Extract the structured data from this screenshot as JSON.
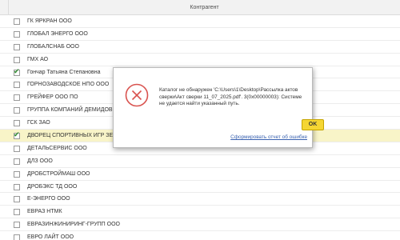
{
  "table": {
    "column_header": "Контрагент",
    "rows": [
      {
        "name": "ГК ЯРКРАН ООО",
        "checked": false
      },
      {
        "name": "ГЛОБАЛ ЭНЕРГО ООО",
        "checked": false
      },
      {
        "name": "ГЛОБАЛСНАБ ООО",
        "checked": false
      },
      {
        "name": "ГМХ АО",
        "checked": false
      },
      {
        "name": "Гончар Татьяна Степановна",
        "checked": true
      },
      {
        "name": "ГОРНОЗАВОДСКОЕ НПО ООО",
        "checked": false
      },
      {
        "name": "ГРЕЙФЕР ООО ПО",
        "checked": false
      },
      {
        "name": "ГРУППА КОМПАНИЙ ДЕМИДОВ",
        "checked": false
      },
      {
        "name": "ГСК ЗАО",
        "checked": false
      },
      {
        "name": "ДВОРЕЦ СПОРТИВНЫХ ИГР ЗЕ",
        "checked": true
      },
      {
        "name": "ДЕТАЛЬСЕРВИС ООО",
        "checked": false
      },
      {
        "name": "ДЛЗ ООО",
        "checked": false
      },
      {
        "name": "ДРОБСТРОЙМАШ ООО",
        "checked": false
      },
      {
        "name": "ДРОБЭКС ТД ООО",
        "checked": false
      },
      {
        "name": "Е-ЭНЕРГО ООО",
        "checked": false
      },
      {
        "name": "ЕВРАЗ НТМК",
        "checked": false
      },
      {
        "name": "ЕВРАЗИНЖИНИРИНГ-ГРУПП ООО",
        "checked": false
      },
      {
        "name": "ЕВРО ЛАЙТ ООО",
        "checked": false
      }
    ]
  },
  "dialog": {
    "message": "Каталог не обнаружен 'C:\\Users\\1\\Desktop\\Рассылка актов сверки\\Акт сверки 11_07_2025.pdf'. 3(0x00000003): Системе не удается найти указанный путь.",
    "ok_label": "OK",
    "report_link": "Сформировать отчет об ошибке",
    "icon": "error-x-icon"
  },
  "colors": {
    "selected_row": "#f8f4c8",
    "ok_button": "#f5d633",
    "error_icon": "#d9534f",
    "link": "#3a62b0",
    "check": "#2c8a2c"
  }
}
